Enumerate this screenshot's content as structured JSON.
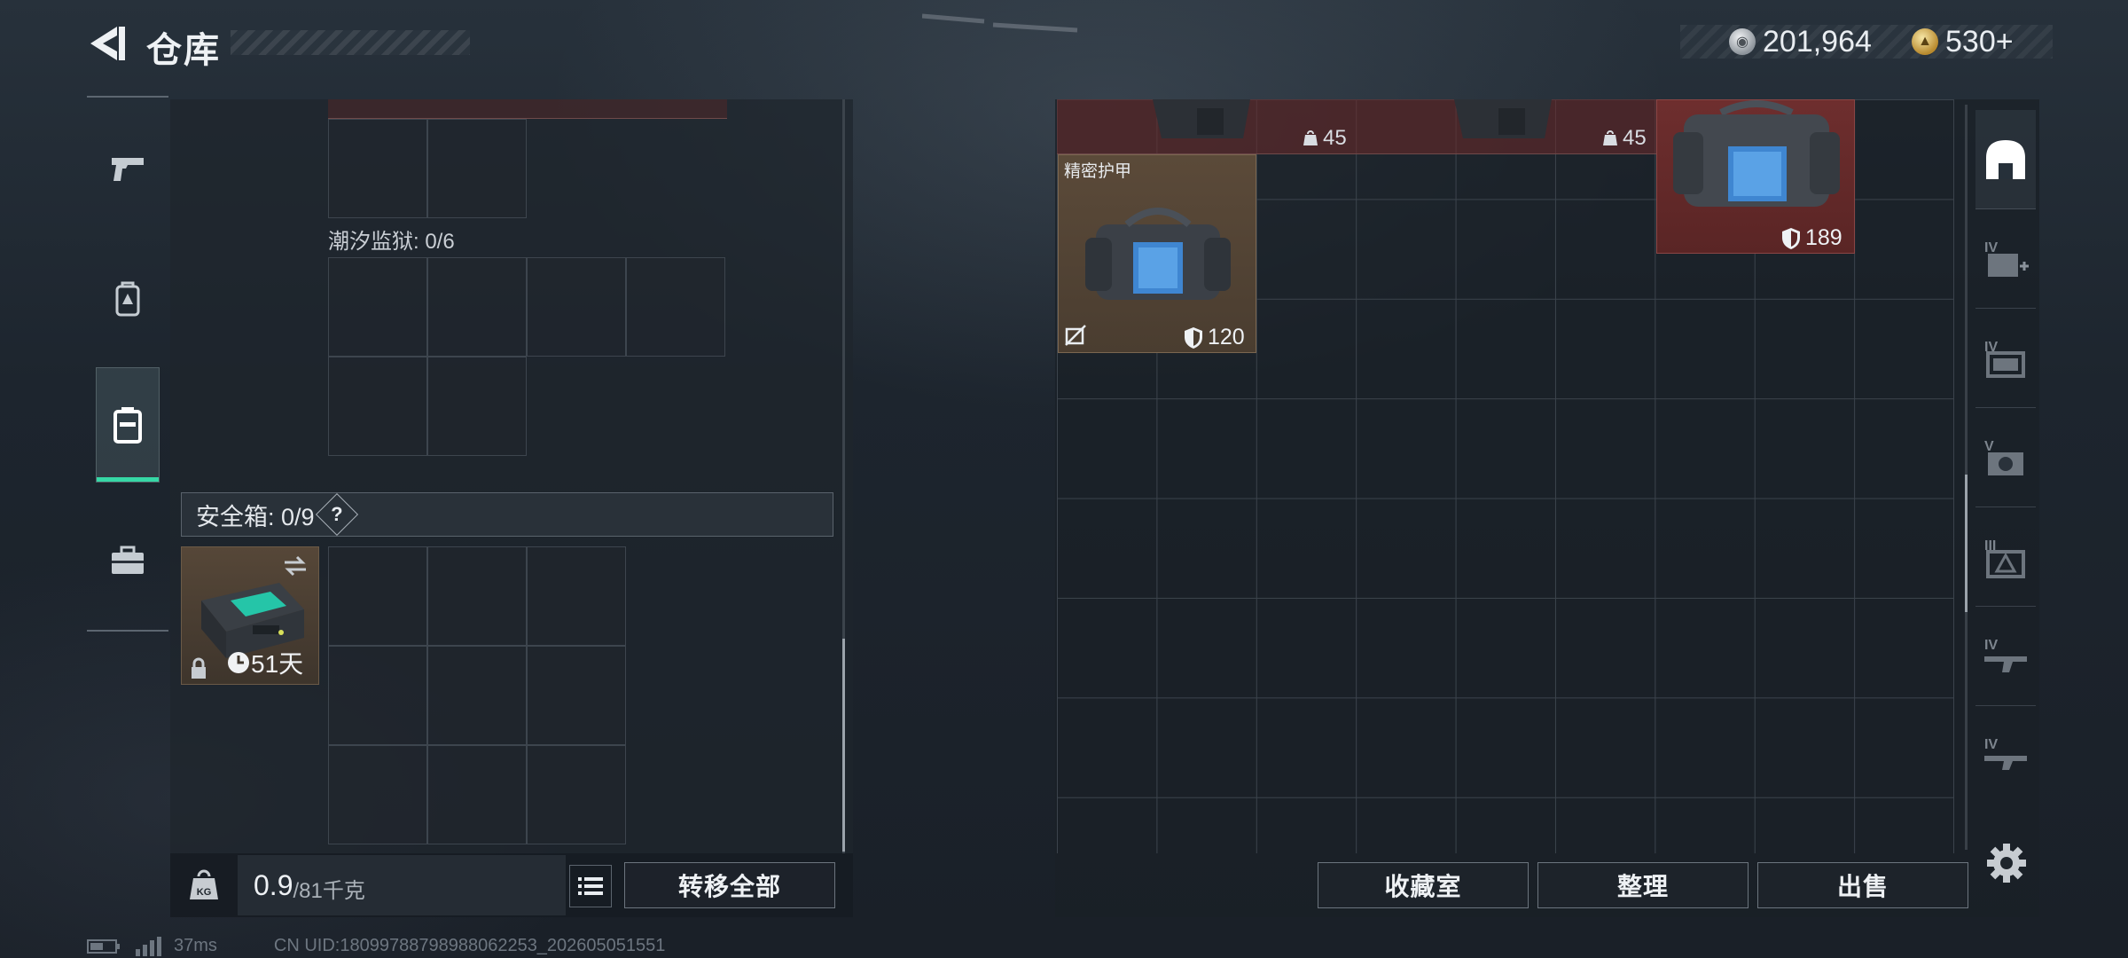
{
  "header": {
    "title": "仓库",
    "currency": [
      {
        "icon": "silver-coin-icon",
        "value": "201,964"
      },
      {
        "icon": "gold-coin-icon",
        "value": "530+"
      }
    ]
  },
  "left_rail": {
    "items": [
      {
        "name": "weapons",
        "icon": "pistol-icon",
        "active": false
      },
      {
        "name": "backpack",
        "icon": "backpack-icon",
        "active": false
      },
      {
        "name": "containers",
        "icon": "case-icon",
        "active": true
      },
      {
        "name": "toolbox",
        "icon": "briefcase-icon",
        "active": false
      }
    ]
  },
  "left_panel": {
    "container_label": "潮汐监狱: 0/6",
    "safe_box_label": "安全箱: 0/9",
    "safe_box_help": "?",
    "safe_item_time": "51天",
    "weight_value": "0.9",
    "weight_max": "/81千克",
    "kg_label": "KG",
    "transfer_all": "转移全部"
  },
  "right_panel": {
    "strip_counts": [
      "45",
      "45"
    ],
    "item1_name": "精密护甲",
    "item1_durability": "120",
    "item2_durability": "189",
    "buttons": {
      "collection": "收藏室",
      "organize": "整理",
      "sell": "出售"
    }
  },
  "right_rail": {
    "items": [
      {
        "name": "all",
        "icon": "home-arch-icon",
        "active": true
      },
      {
        "name": "medical",
        "icon": "medkit-icon",
        "tier": "IV"
      },
      {
        "name": "ammo",
        "icon": "ammo-box-icon",
        "tier": "IV"
      },
      {
        "name": "valuables",
        "icon": "camera-icon",
        "tier": "V"
      },
      {
        "name": "materials",
        "icon": "warning-crate-icon",
        "tier": "III"
      },
      {
        "name": "weapons",
        "icon": "rifle-icon",
        "tier": "IV"
      },
      {
        "name": "weapons2",
        "icon": "rifle2-icon",
        "tier": "IV"
      }
    ]
  },
  "footer": {
    "ping": "37ms",
    "uid": "CN UID:18099788798988062253_202605051551"
  },
  "colors": {
    "accent": "#36d8a6",
    "rarity_red": "#6e2e2e",
    "rarity_brown": "#5b4a39"
  }
}
